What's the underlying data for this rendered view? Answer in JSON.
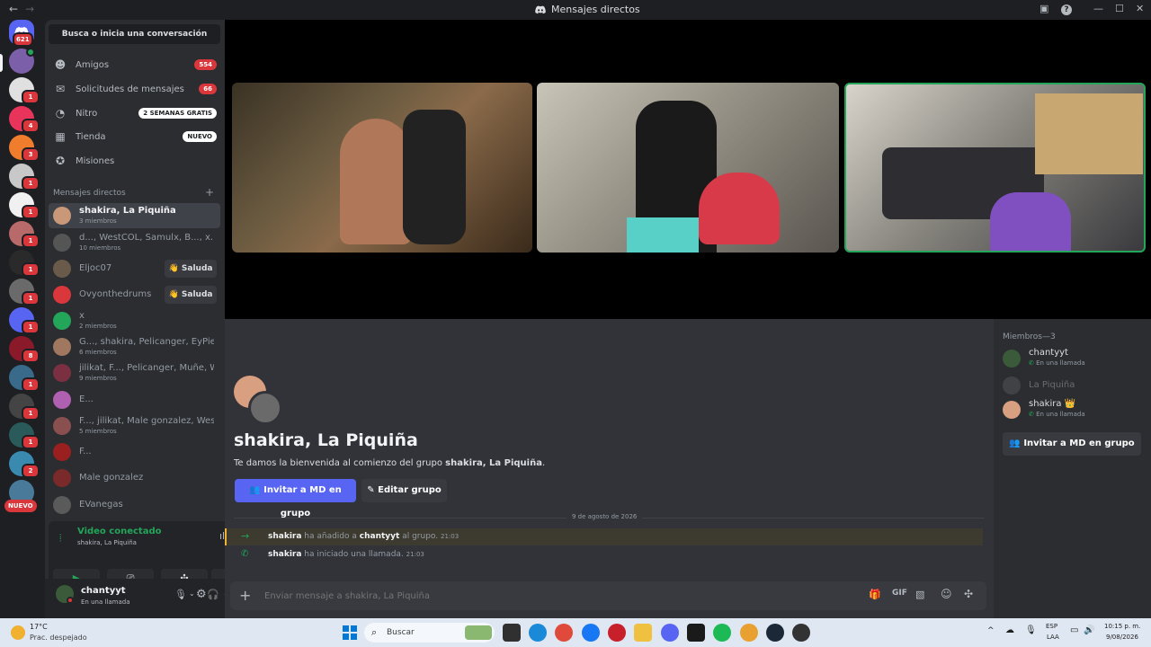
{
  "window": {
    "title": "Mensajes directos"
  },
  "rail": {
    "home_badge": "621",
    "servers": [
      {
        "badge": ""
      },
      {
        "badge": "1"
      },
      {
        "badge": "4"
      },
      {
        "badge": "3"
      },
      {
        "badge": "1"
      },
      {
        "badge": "1"
      },
      {
        "badge": "1"
      },
      {
        "badge": "1"
      },
      {
        "badge": "1"
      },
      {
        "badge": "1"
      },
      {
        "badge": "8"
      },
      {
        "badge": "1"
      },
      {
        "badge": "1"
      },
      {
        "badge": "1"
      },
      {
        "badge": "2"
      }
    ],
    "new_label": "NUEVO"
  },
  "sidebar": {
    "search_label": "Busca o inicia una conversación",
    "nav": [
      {
        "label": "Amigos",
        "pill": "554",
        "icon": "friends-icon"
      },
      {
        "label": "Solicitudes de mensajes",
        "pill": "66",
        "icon": "inbox-icon"
      },
      {
        "label": "Nitro",
        "pill": "2 SEMANAS GRATIS",
        "icon": "nitro-icon"
      },
      {
        "label": "Tienda",
        "pill": "NUEVO",
        "icon": "shop-icon"
      },
      {
        "label": "Misiones",
        "pill": "",
        "icon": "quests-icon"
      }
    ],
    "dm_header": "Mensajes directos",
    "dms": [
      {
        "name": "shakira, La Piquiña",
        "sub": "3 miembros",
        "active": true
      },
      {
        "name": "d..., WestCOL, Samulx, B..., x..., ...",
        "sub": "10 miembros"
      },
      {
        "name": "Eljoc07",
        "sub": "",
        "action": "Saluda"
      },
      {
        "name": "Ovyonthedrums",
        "sub": "",
        "action": "Saluda"
      },
      {
        "name": "x",
        "sub": "2 miembros"
      },
      {
        "name": "G..., shakira, Pelicanger, EyPied...",
        "sub": "6 miembros"
      },
      {
        "name": "jilikat, F..., Pelicanger, Muñe, W...",
        "sub": "9 miembros"
      },
      {
        "name": "E...",
        "sub": ""
      },
      {
        "name": "F..., jilikat, Male gonzalez, West...",
        "sub": "5 miembros"
      },
      {
        "name": "F...",
        "sub": ""
      },
      {
        "name": "Male gonzalez",
        "sub": ""
      },
      {
        "name": "EVanegas",
        "sub": ""
      }
    ],
    "wave_emoji": "👋"
  },
  "voice": {
    "status": "Video conectado",
    "channel": "shakira, La Piquiña"
  },
  "user": {
    "name": "chantyyt",
    "status": "En una llamada"
  },
  "chat": {
    "group_title": "shakira, La Piquiña",
    "welcome_prefix": "Te damos la bienvenida al comienzo del grupo ",
    "welcome_group": "shakira, La Piquiña",
    "welcome_suffix": ".",
    "invite_button": "Invitar a MD en grupo",
    "edit_button": "Editar grupo",
    "date_divider": "9 de agosto de 2026",
    "messages": [
      {
        "actor": "shakira",
        "verb": " ha añadido a ",
        "target": "chantyyt",
        "tail": " al grupo.",
        "time": "21:03"
      },
      {
        "actor": "shakira",
        "verb": " ha iniciado una llamada.",
        "target": "",
        "tail": "",
        "time": "21:03"
      }
    ],
    "input_placeholder": "Enviar mensaje a shakira, La Piquiña"
  },
  "members": {
    "header": "Miembros—3",
    "list": [
      {
        "name": "chantyyt",
        "status": "En una llamada"
      },
      {
        "name": "La Piquiña",
        "status": ""
      },
      {
        "name": "shakira",
        "status": "En una llamada",
        "crown": "👑"
      }
    ],
    "invite_button": "Invitar a MD en grupo"
  },
  "taskbar": {
    "weather_temp": "17°C",
    "weather_desc": "Prac. despejado",
    "search_placeholder": "Buscar",
    "lang_top": "ESP",
    "lang_bottom": "LAA",
    "time": "10:15 p. m.",
    "date": "9/08/2026"
  },
  "colors": {
    "accent": "#5865f2",
    "red": "#da373c",
    "green": "#23a55a",
    "bg_dark": "#1e1f22",
    "bg_side": "#2b2d31",
    "bg_chat": "#313338"
  }
}
